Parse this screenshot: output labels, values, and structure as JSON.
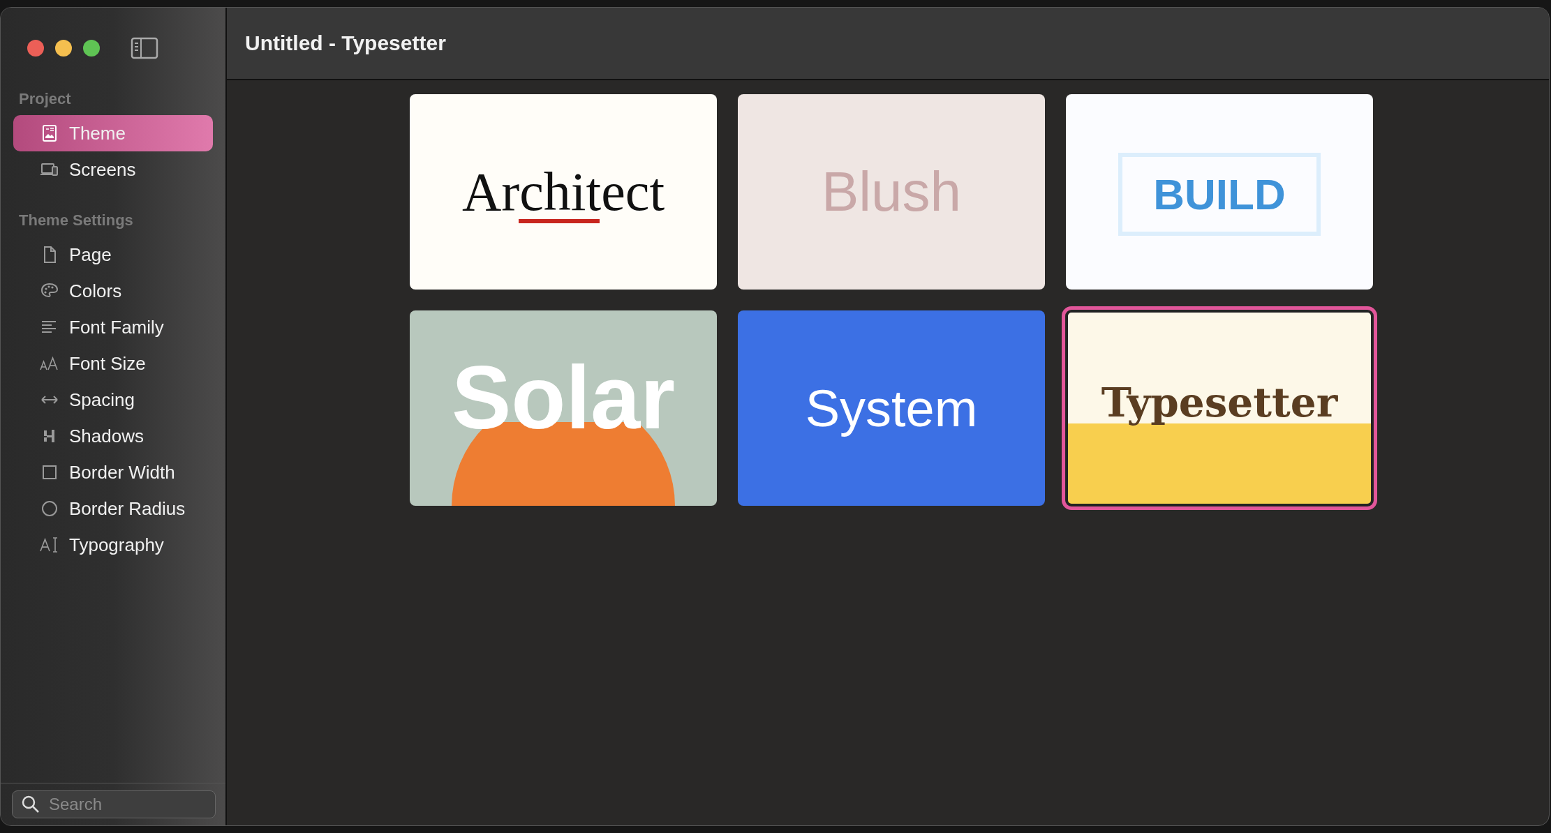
{
  "window": {
    "title": "Untitled - Typesetter"
  },
  "sidebar": {
    "sections": [
      {
        "heading": "Project",
        "items": [
          {
            "label": "Theme",
            "selected": true
          },
          {
            "label": "Screens",
            "selected": false
          }
        ]
      },
      {
        "heading": "Theme Settings",
        "items": [
          {
            "label": "Page",
            "selected": false
          },
          {
            "label": "Colors",
            "selected": false
          },
          {
            "label": "Font Family",
            "selected": false
          },
          {
            "label": "Font Size",
            "selected": false
          },
          {
            "label": "Spacing",
            "selected": false
          },
          {
            "label": "Shadows",
            "selected": false
          },
          {
            "label": "Border Width",
            "selected": false
          },
          {
            "label": "Border Radius",
            "selected": false
          },
          {
            "label": "Typography",
            "selected": false
          }
        ]
      }
    ]
  },
  "search": {
    "placeholder": "Search"
  },
  "themes": [
    {
      "name": "Architect",
      "kind": "architect",
      "selected": false
    },
    {
      "name": "Blush",
      "kind": "blush",
      "selected": false
    },
    {
      "name": "BUILD",
      "kind": "build",
      "selected": false
    },
    {
      "name": "Solar",
      "kind": "solar",
      "selected": false
    },
    {
      "name": "System",
      "kind": "system",
      "selected": false
    },
    {
      "name": "Typesetter",
      "kind": "typesetter",
      "selected": true
    }
  ]
}
